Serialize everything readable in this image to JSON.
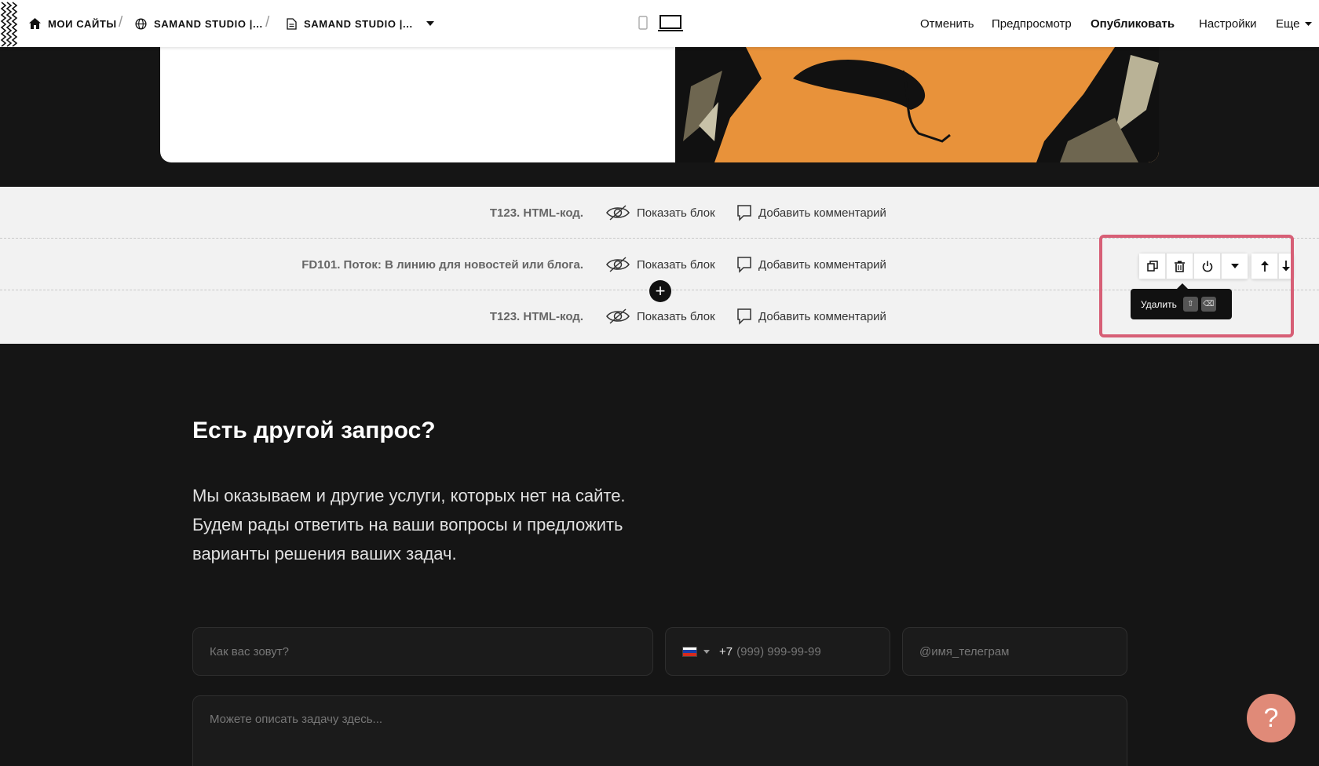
{
  "topbar": {
    "breadcrumbs": [
      {
        "label": "МОИ САЙТЫ",
        "icon": "home-icon"
      },
      {
        "label": "SAMAND STUDIO |...",
        "icon": "globe-icon"
      },
      {
        "label": "SAMAND STUDIO |...",
        "icon": "page-icon"
      }
    ],
    "separator": "/",
    "nav": {
      "cancel": "Отменить",
      "preview": "Предпросмотр",
      "publish": "Опубликовать",
      "settings": "Настройки",
      "more": "Еще"
    }
  },
  "hidden_blocks": [
    {
      "title": "T123. HTML-код.",
      "show_label": "Показать блок",
      "comment_label": "Добавить комментарий"
    },
    {
      "title": "FD101. Поток: В линию для новостей или блога.",
      "show_label": "Показать блок",
      "comment_label": "Добавить комментарий"
    },
    {
      "title": "T123. HTML-код.",
      "show_label": "Показать блок",
      "comment_label": "Добавить комментарий"
    }
  ],
  "add_block_symbol": "+",
  "toolbar": {
    "tooltip": "Удалить",
    "icons": [
      "duplicate-icon",
      "trash-icon",
      "power-icon",
      "chevron-down-icon",
      "arrow-up-icon",
      "arrow-down-icon"
    ]
  },
  "contact": {
    "title": "Есть другой запрос?",
    "text_lines": [
      "Мы оказываем и другие услуги, которых нет на сайте.",
      "Будем рады ответить на ваши вопросы и предложить",
      "варианты решения ваших задач."
    ],
    "name_placeholder": "Как вас зовут?",
    "phone_code": "+7",
    "phone_placeholder": "(999) 999-99-99",
    "telegram_placeholder": "@имя_телеграм",
    "message_placeholder": "Можете описать задачу здесь..."
  },
  "help_symbol": "?",
  "colors": {
    "highlight": "#d75f76",
    "help_button": "#e08a78",
    "dark_bg": "#151515",
    "hero_orange": "#e8923a"
  }
}
